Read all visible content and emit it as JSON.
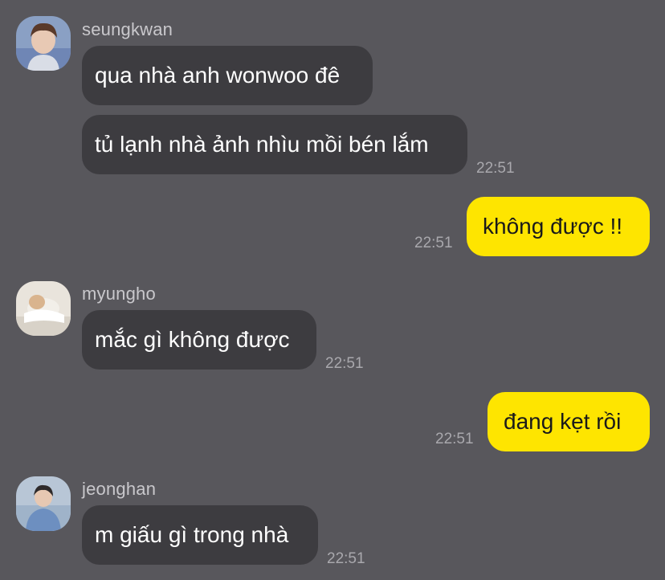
{
  "messages": [
    {
      "sender": "seungkwan",
      "avatar": "seungkwan-avatar",
      "bubbles": [
        "qua nhà anh wonwoo đê",
        "tủ lạnh nhà ảnh nhìu mồi bén lắm"
      ],
      "time": "22:51"
    },
    {
      "outgoing": true,
      "text": "không được !!",
      "time": "22:51"
    },
    {
      "sender": "myungho",
      "avatar": "myungho-avatar",
      "bubbles": [
        "mắc gì không được"
      ],
      "time": "22:51"
    },
    {
      "outgoing": true,
      "text": "đang kẹt rồi",
      "time": "22:51"
    },
    {
      "sender": "jeonghan",
      "avatar": "jeonghan-avatar",
      "bubbles": [
        "m giấu gì trong nhà"
      ],
      "time": "22:51"
    }
  ],
  "colors": {
    "background": "#58575c",
    "incoming_bubble": "#3d3c40",
    "outgoing_bubble": "#fee500"
  }
}
